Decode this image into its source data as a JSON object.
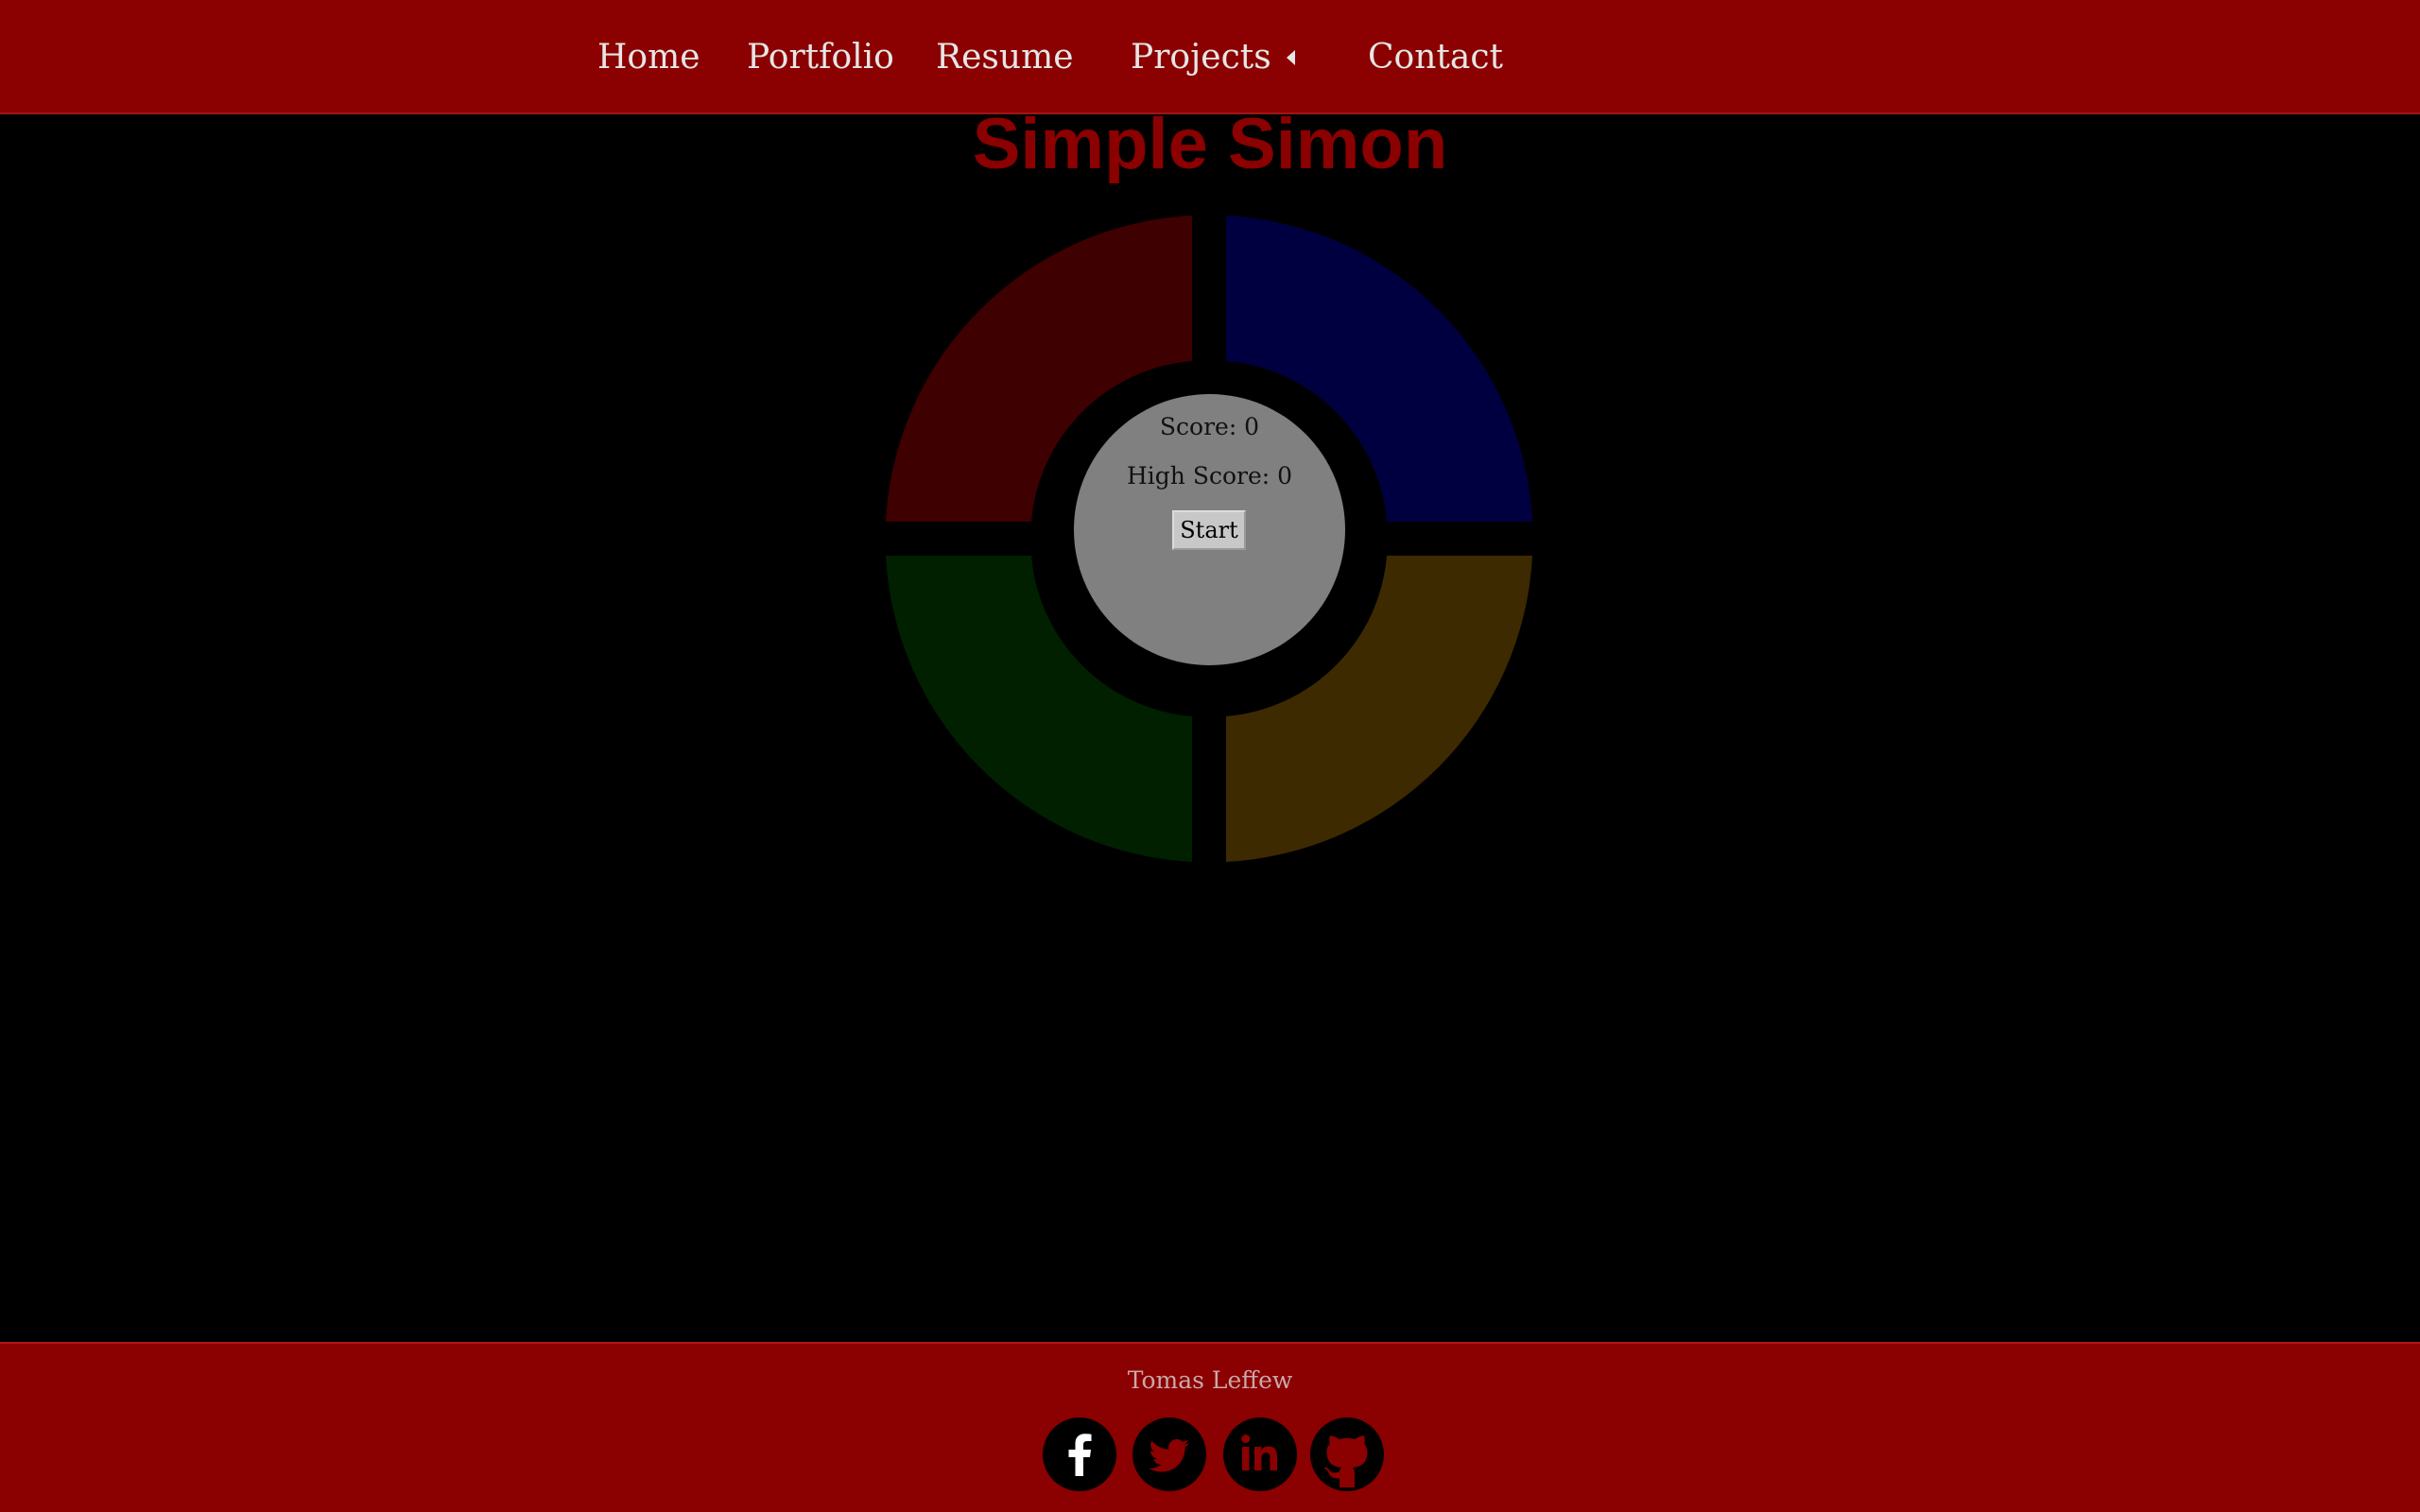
{
  "nav": {
    "items": [
      "Home",
      "Portfolio",
      "Resume",
      "Projects",
      "Contact"
    ]
  },
  "game": {
    "title": "Simple Simon",
    "score_text": "Score: 0",
    "high_score_text": "High Score: 0",
    "start_label": "Start",
    "colors": {
      "red": "#3e0000",
      "blue": "#000040",
      "green": "#002000",
      "yellow": "#3e2a00",
      "center": "#808080"
    }
  },
  "footer": {
    "name": "Tomas Leffew",
    "social_icons": [
      "facebook-icon",
      "twitter-icon",
      "linkedin-icon",
      "github-icon"
    ]
  },
  "theme": {
    "brand": "#8b0000",
    "background": "#000000"
  }
}
